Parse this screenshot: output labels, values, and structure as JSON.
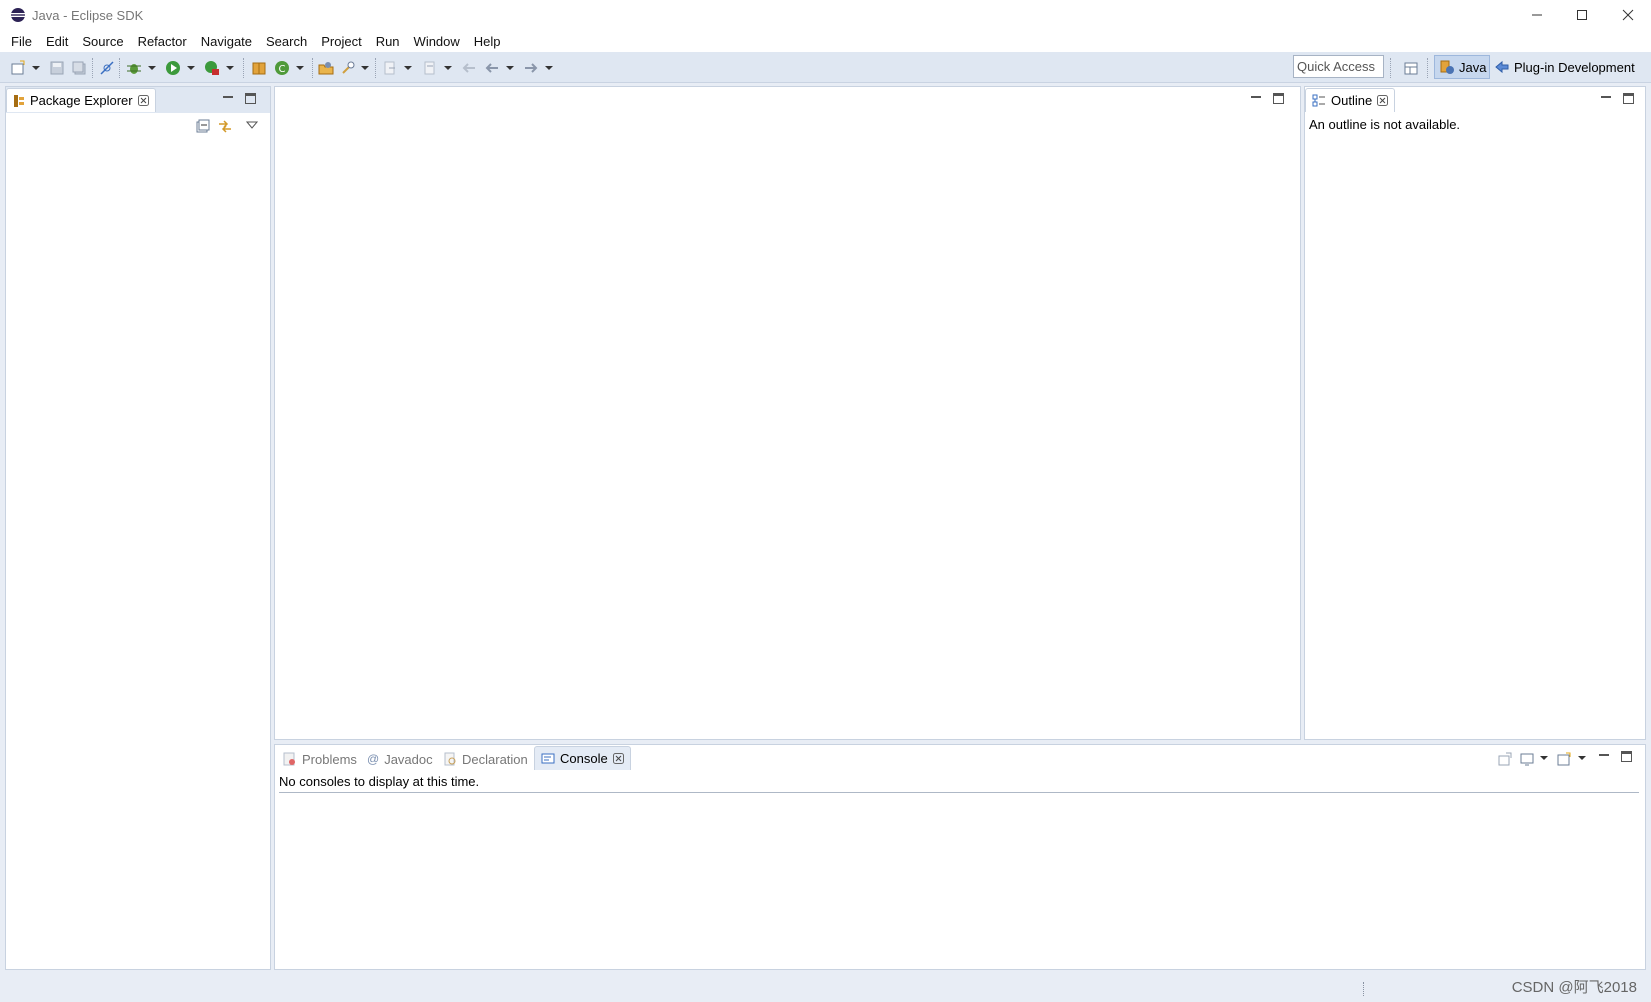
{
  "window": {
    "title": "Java - Eclipse SDK",
    "controls": [
      "minimize",
      "maximize",
      "close"
    ]
  },
  "menubar": {
    "items": [
      "File",
      "Edit",
      "Source",
      "Refactor",
      "Navigate",
      "Search",
      "Project",
      "Run",
      "Window",
      "Help"
    ]
  },
  "toolbar": {
    "quick_access_placeholder": "Quick Access",
    "perspectives": {
      "java_label": "Java",
      "plugin_label": "Plug-in Development"
    }
  },
  "package_explorer": {
    "tab_label": "Package Explorer"
  },
  "outline": {
    "tab_label": "Outline",
    "message": "An outline is not available."
  },
  "bottom_panel": {
    "tabs": [
      {
        "label": "Problems",
        "active": false
      },
      {
        "label": "Javadoc",
        "active": false
      },
      {
        "label": "Declaration",
        "active": false
      },
      {
        "label": "Console",
        "active": true
      }
    ],
    "message": "No consoles to display at this time."
  },
  "watermark": "CSDN @阿飞2018",
  "colors": {
    "background": "#e8edf5",
    "toolbar": "#dfe7f2",
    "active_perspective": "#c6d7ee"
  }
}
